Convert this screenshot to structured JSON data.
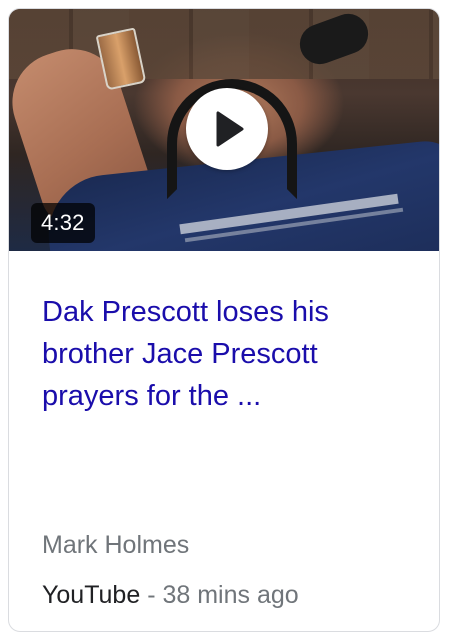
{
  "video": {
    "duration": "4:32",
    "title": "Dak Prescott loses his brother Jace Prescott prayers for the ...",
    "author": "Mark Holmes",
    "source": "YouTube",
    "separator": " - ",
    "time_ago": "38 mins ago"
  },
  "icons": {
    "play": "play-icon"
  },
  "colors": {
    "title_link": "#1a0dab",
    "secondary_text": "#70757a",
    "primary_text": "#202124",
    "card_border": "#dadce0"
  }
}
